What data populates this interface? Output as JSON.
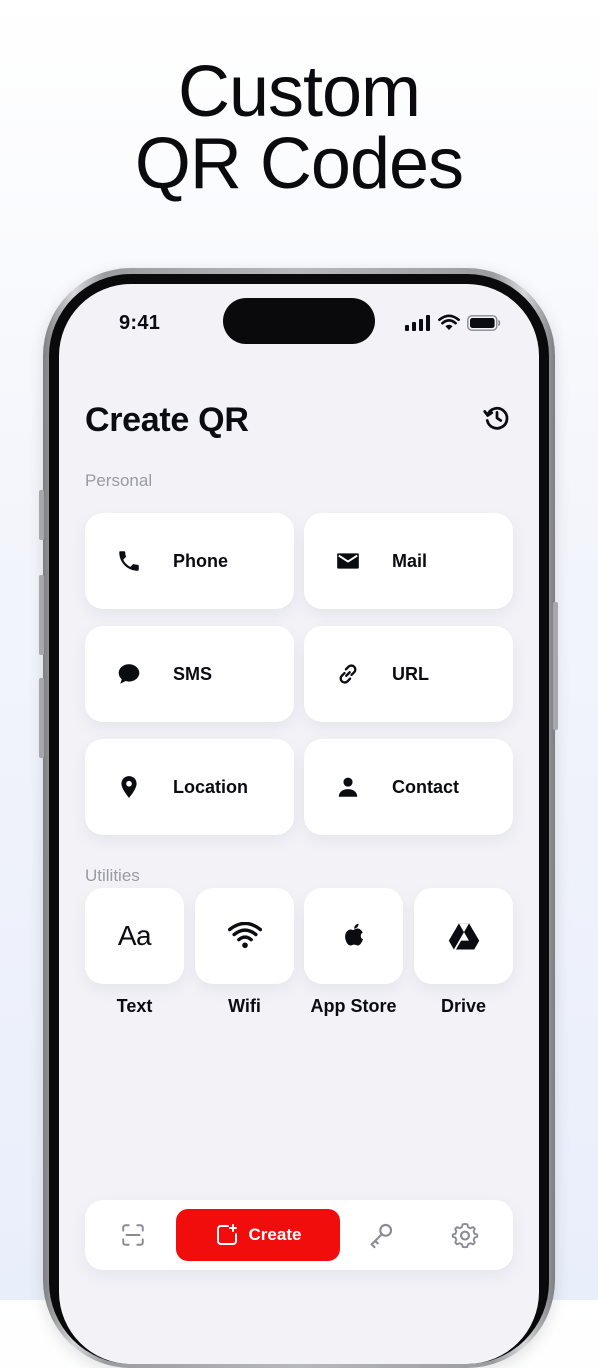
{
  "headline": {
    "line1": "Custom",
    "line2": "QR Codes"
  },
  "status_bar": {
    "time": "9:41"
  },
  "screen": {
    "title": "Create QR",
    "personal_label": "Personal",
    "personal_items": [
      {
        "label": "Phone",
        "icon": "phone-icon"
      },
      {
        "label": "Mail",
        "icon": "mail-icon"
      },
      {
        "label": "SMS",
        "icon": "sms-icon"
      },
      {
        "label": "URL",
        "icon": "link-icon"
      },
      {
        "label": "Location",
        "icon": "location-icon"
      },
      {
        "label": "Contact",
        "icon": "contact-icon"
      }
    ],
    "utilities_label": "Utilities",
    "utility_items": [
      {
        "label": "Text",
        "icon": "text-icon",
        "glyph": "Aa"
      },
      {
        "label": "Wifi",
        "icon": "wifi-icon"
      },
      {
        "label": "App Store",
        "icon": "apple-icon"
      },
      {
        "label": "Drive",
        "icon": "drive-icon"
      }
    ]
  },
  "tabbar": {
    "create_label": "Create"
  },
  "colors": {
    "accent": "#f20d0d",
    "background": "#f2f2f7",
    "text": "#0b0b12",
    "muted": "#9a9aa2"
  }
}
